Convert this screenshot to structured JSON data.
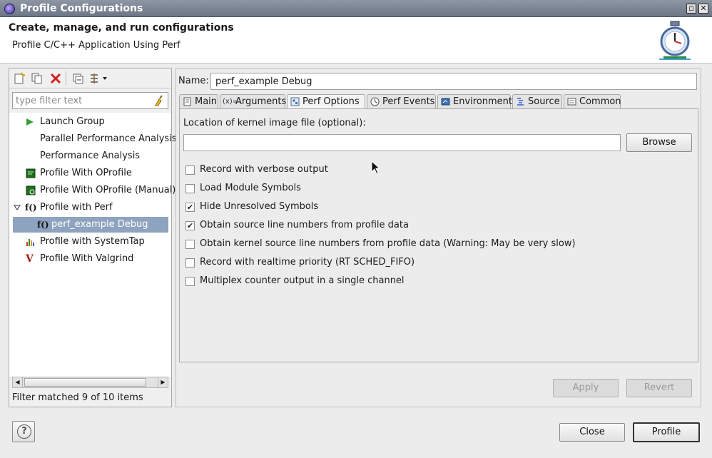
{
  "window": {
    "title": "Profile Configurations",
    "controls": [
      "restore",
      "close"
    ]
  },
  "header": {
    "title": "Create, manage, and run configurations",
    "subtitle": "Profile C/C++ Application Using Perf",
    "icon": "stopwatch-icon"
  },
  "left": {
    "toolbar": [
      "new-config-icon",
      "duplicate-icon",
      "delete-icon",
      "collapse-all-icon",
      "filter-menu-icon"
    ],
    "filter_placeholder": "type filter text",
    "tree": [
      {
        "label": "Launch Group",
        "icon": "launch-group-icon",
        "depth": 1
      },
      {
        "label": "Parallel Performance Analysis",
        "icon": "",
        "depth": 1
      },
      {
        "label": "Performance Analysis",
        "icon": "",
        "depth": 1
      },
      {
        "label": "Profile With OProfile",
        "icon": "oprofile-icon",
        "depth": 1
      },
      {
        "label": "Profile With OProfile (Manual)",
        "icon": "oprofile-manual-icon",
        "depth": 1
      },
      {
        "label": "Profile with Perf",
        "icon": "perf-icon",
        "depth": 1,
        "expanded": true
      },
      {
        "label": "perf_example Debug",
        "icon": "perf-icon",
        "depth": 2,
        "selected": true
      },
      {
        "label": "Profile with SystemTap",
        "icon": "systemtap-icon",
        "depth": 1
      },
      {
        "label": "Profile With Valgrind",
        "icon": "valgrind-icon",
        "depth": 1
      }
    ],
    "status": "Filter matched 9 of 10 items"
  },
  "right": {
    "name_label": "Name:",
    "name_value": "perf_example Debug",
    "tabs": [
      {
        "label": "Main",
        "icon": "main-tab-icon"
      },
      {
        "label": "Arguments",
        "icon": "arguments-tab-icon"
      },
      {
        "label": "Perf Options",
        "icon": "perf-options-tab-icon",
        "active": true
      },
      {
        "label": "Perf Events",
        "icon": "perf-events-tab-icon"
      },
      {
        "label": "Environment",
        "icon": "environment-tab-icon"
      },
      {
        "label": "Source",
        "icon": "source-tab-icon"
      },
      {
        "label": "Common",
        "icon": "common-tab-icon"
      }
    ],
    "kernel_label": "Location of kernel image file (optional):",
    "kernel_value": "",
    "browse_label": "Browse",
    "options": [
      {
        "label": "Record with verbose output",
        "checked": false
      },
      {
        "label": "Load Module Symbols",
        "checked": false
      },
      {
        "label": "Hide Unresolved Symbols",
        "checked": true
      },
      {
        "label": "Obtain source line numbers from profile data",
        "checked": true
      },
      {
        "label": "Obtain kernel source line numbers from profile data (Warning: May be very slow)",
        "checked": false
      },
      {
        "label": "Record with realtime priority (RT SCHED_FIFO)",
        "checked": false
      },
      {
        "label": "Multiplex counter output in a single channel",
        "checked": false
      }
    ],
    "apply_label": "Apply",
    "revert_label": "Revert"
  },
  "footer": {
    "close_label": "Close",
    "profile_label": "Profile"
  }
}
